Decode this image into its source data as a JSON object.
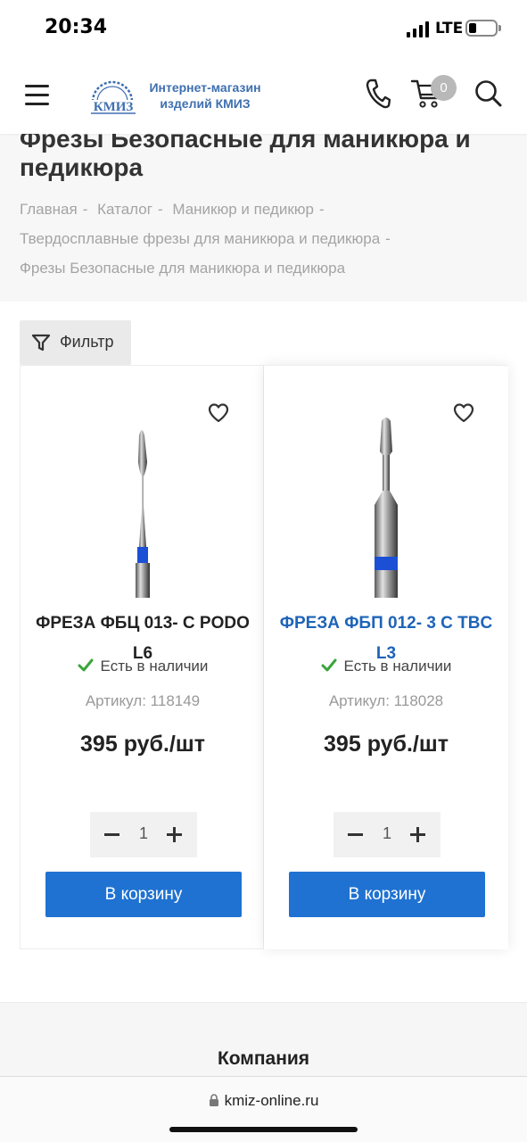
{
  "status_bar": {
    "time": "20:34",
    "network": "LTE"
  },
  "header": {
    "logo_abbr": "КМИЗ",
    "logo_line1": "Интернет-магазин",
    "logo_line2": "изделий КМИЗ",
    "cart_count": "0",
    "icons": [
      "menu-icon",
      "phone-icon",
      "cart-icon",
      "search-icon"
    ]
  },
  "page": {
    "title": "Фрезы Безопасные для маникюра и педикюра",
    "breadcrumbs": [
      "Главная",
      "Каталог",
      "Маникюр и педикюр",
      "Твердосплавные фрезы для маникюра и педикюра",
      "Фрезы Безопасные для маникюра и педикюра"
    ]
  },
  "filter": {
    "label": "Фильтр"
  },
  "products": [
    {
      "name": "ФРЕЗА ФБЦ 013- С PODO L6",
      "stock": "Есть в наличии",
      "sku": "Артикул: 118149",
      "price": "395 руб./шт",
      "qty": "1",
      "cart_label": "В корзину"
    },
    {
      "name": "ФРЕЗА ФБП 012- 3 С TBC L3",
      "stock": "Есть в наличии",
      "sku": "Артикул: 118028",
      "price": "395 руб./шт",
      "qty": "1",
      "cart_label": "В корзину"
    }
  ],
  "footer": {
    "title": "Компания"
  },
  "browser": {
    "url": "kmiz-online.ru"
  },
  "colors": {
    "accent": "#1f72d1",
    "link": "#1e64b8",
    "logo": "#3e6fb0",
    "stock_check": "#3aa53a",
    "band_blue": "#1a4fd6"
  }
}
